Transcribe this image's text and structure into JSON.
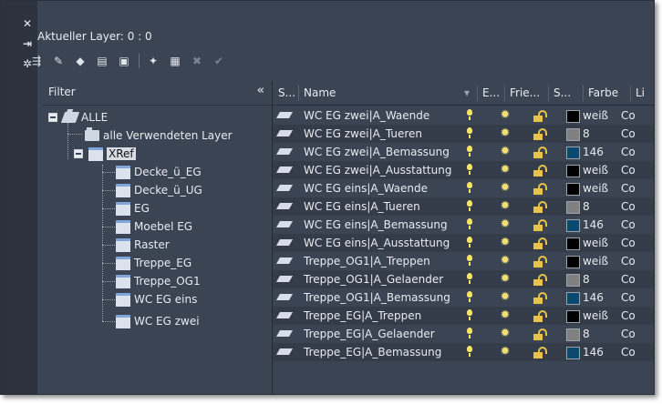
{
  "sidebar": {
    "icons": [
      "close-icon",
      "pin-icon",
      "settings-icon"
    ],
    "glyphs": [
      "✕",
      "⇥",
      "✲"
    ]
  },
  "header": {
    "current_layer": "Aktueller Layer: 0 : 0"
  },
  "toolbar": {
    "buttons": [
      {
        "name": "new-layer-state-icon",
        "glyph": "⇶"
      },
      {
        "name": "layer-properties-icon",
        "glyph": "✎"
      },
      {
        "name": "layer-filter-icon",
        "glyph": "◆"
      },
      {
        "name": "layer-group-icon",
        "glyph": "▤"
      },
      {
        "name": "save-icon",
        "glyph": "▣"
      },
      {
        "name": "new-layer-icon",
        "glyph": "✦"
      },
      {
        "name": "new-layer-vp-frozen-icon",
        "glyph": "▦"
      },
      {
        "name": "delete-layer-icon",
        "glyph": "✖"
      },
      {
        "name": "set-current-icon",
        "glyph": "✔"
      }
    ]
  },
  "tree": {
    "filter_label": "Filter",
    "collapse_glyph": "«",
    "root": "ALLE",
    "used_layers": "alle Verwendeten Layer",
    "xref": "XRef",
    "xref_children": [
      "Decke_ü_EG",
      "Decke_ü_UG",
      "EG",
      "Moebel EG",
      "Raster",
      "Treppe_EG",
      "Treppe_OG1",
      "WC EG eins",
      "WC EG zwei"
    ]
  },
  "grid": {
    "headers": {
      "status": "S...",
      "name": "Name",
      "on": "E...",
      "freeze": "Frie...",
      "lock": "S...",
      "color": "Farbe",
      "linetype": "Li"
    },
    "rows": [
      {
        "name": "WC EG zwei|A_Waende",
        "color_name": "weiß",
        "swatch": "#000000",
        "linetype": "Co"
      },
      {
        "name": "WC EG zwei|A_Tueren",
        "color_name": "8",
        "swatch": "#808080",
        "linetype": "Co"
      },
      {
        "name": "WC EG zwei|A_Bemassung",
        "color_name": "146",
        "swatch": "#0b4a6e",
        "linetype": "Co"
      },
      {
        "name": "WC EG zwei|A_Ausstattung",
        "color_name": "weiß",
        "swatch": "#000000",
        "linetype": "Co"
      },
      {
        "name": "WC EG eins|A_Waende",
        "color_name": "weiß",
        "swatch": "#000000",
        "linetype": "Co"
      },
      {
        "name": "WC EG eins|A_Tueren",
        "color_name": "8",
        "swatch": "#808080",
        "linetype": "Co"
      },
      {
        "name": "WC EG eins|A_Bemassung",
        "color_name": "146",
        "swatch": "#0b4a6e",
        "linetype": "Co"
      },
      {
        "name": "WC EG eins|A_Ausstattung",
        "color_name": "weiß",
        "swatch": "#000000",
        "linetype": "Co"
      },
      {
        "name": "Treppe_OG1|A_Treppen",
        "color_name": "weiß",
        "swatch": "#000000",
        "linetype": "Co"
      },
      {
        "name": "Treppe_OG1|A_Gelaender",
        "color_name": "8",
        "swatch": "#808080",
        "linetype": "Co"
      },
      {
        "name": "Treppe_OG1|A_Bemassung",
        "color_name": "146",
        "swatch": "#0b4a6e",
        "linetype": "Co"
      },
      {
        "name": "Treppe_EG|A_Treppen",
        "color_name": "weiß",
        "swatch": "#000000",
        "linetype": "Co"
      },
      {
        "name": "Treppe_EG|A_Gelaender",
        "color_name": "8",
        "swatch": "#808080",
        "linetype": "Co"
      },
      {
        "name": "Treppe_EG|A_Bemassung",
        "color_name": "146",
        "swatch": "#0b4a6e",
        "linetype": "Co"
      }
    ]
  }
}
